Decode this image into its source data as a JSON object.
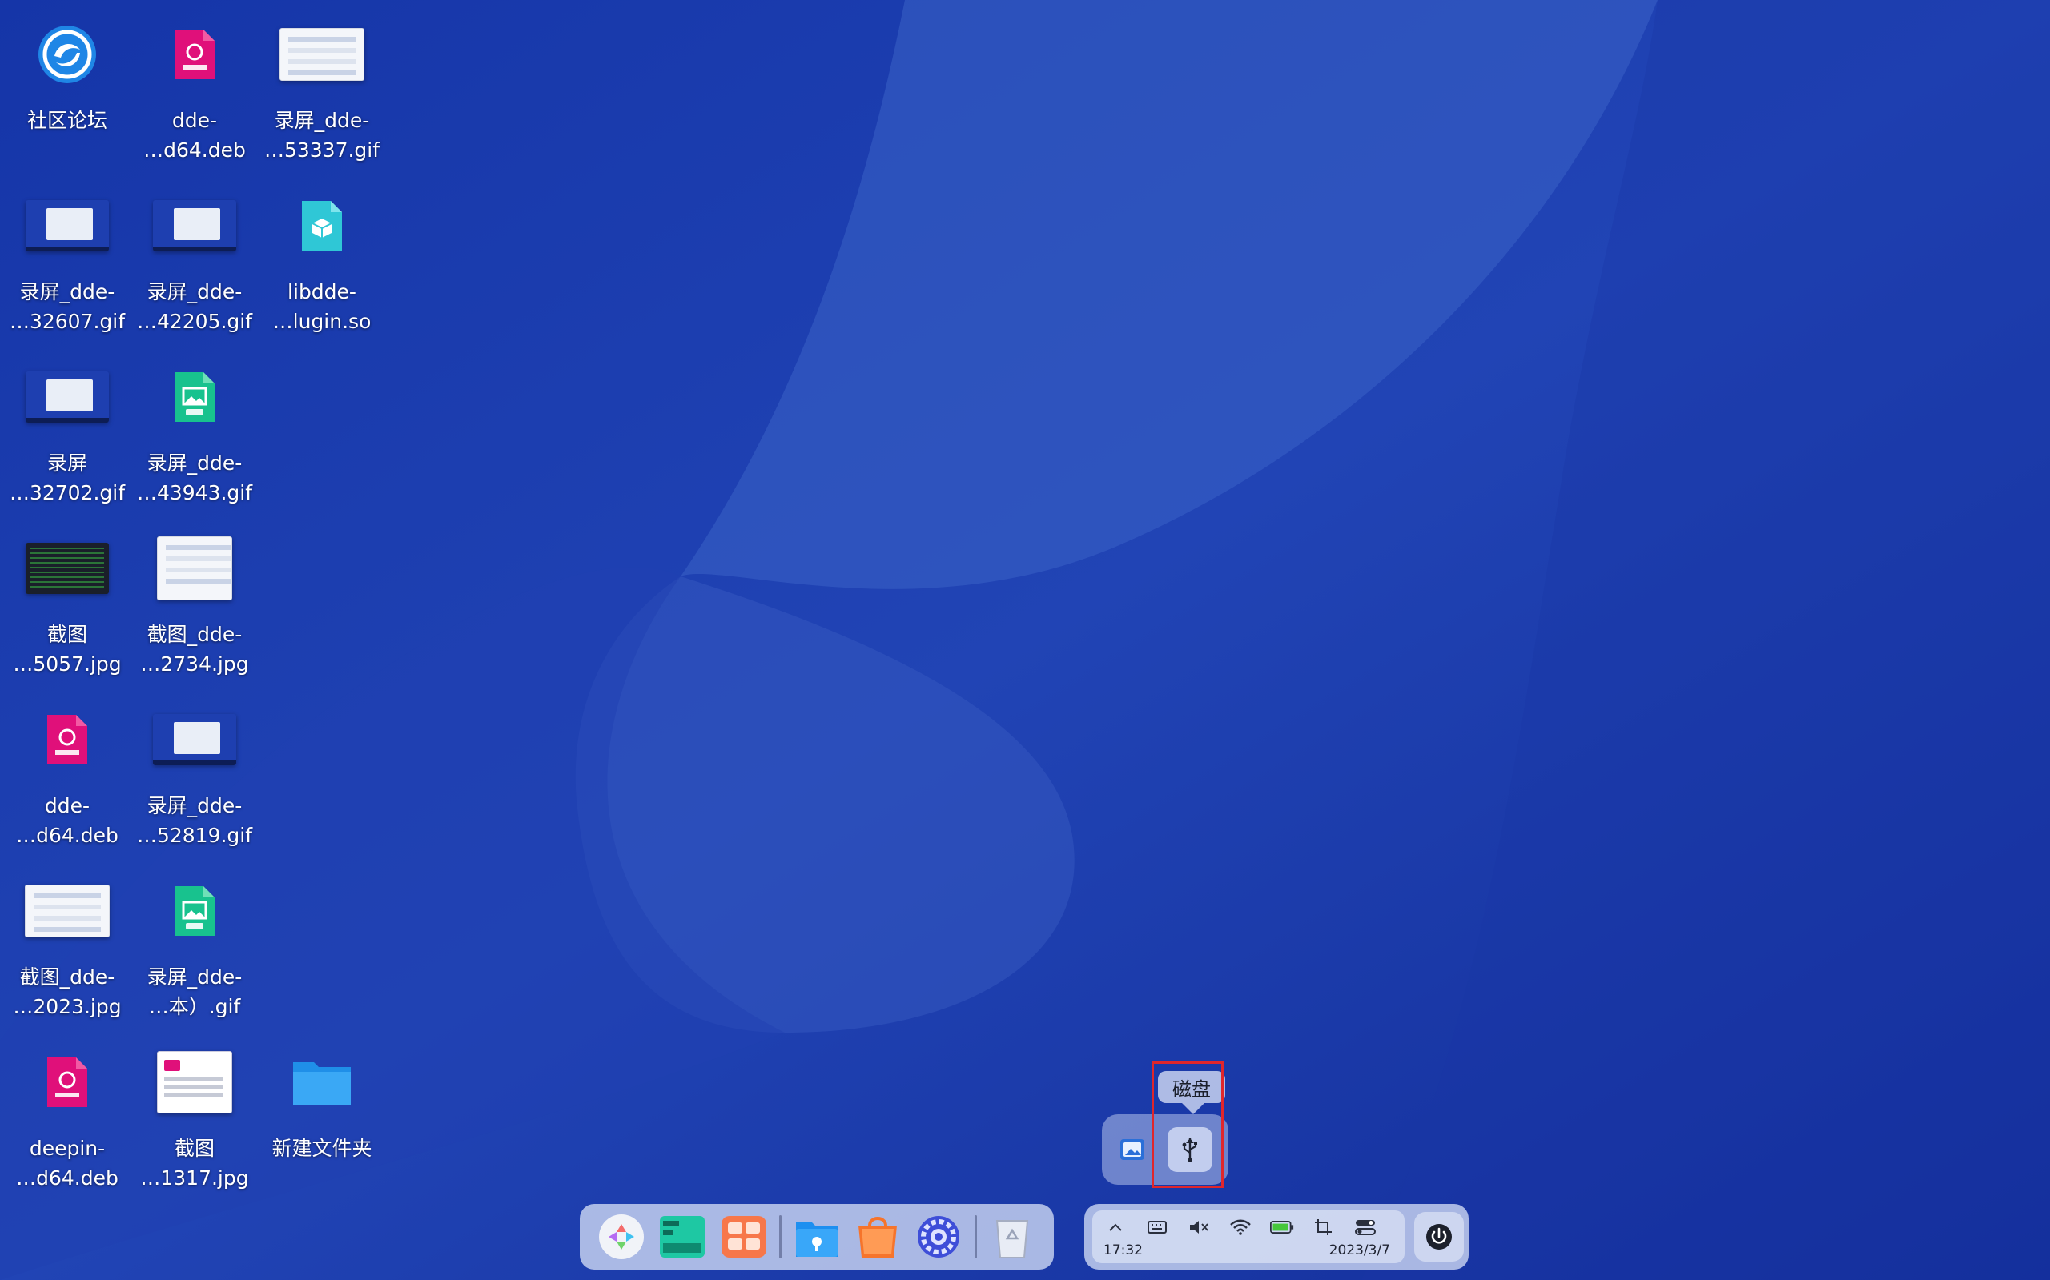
{
  "desktop": {
    "icons": [
      {
        "label": "社区论坛"
      },
      {
        "label": "dde-\n…d64.deb"
      },
      {
        "label": "录屏_dde-\n…53337.gif"
      },
      {
        "label": "录屏_dde-\n…32607.gif"
      },
      {
        "label": "录屏_dde-\n…42205.gif"
      },
      {
        "label": "libdde-\n…lugin.so"
      },
      {
        "label": "录屏\n…32702.gif"
      },
      {
        "label": "录屏_dde-\n…43943.gif"
      },
      {
        "label": "截图\n…5057.jpg"
      },
      {
        "label": "截图_dde-\n…2734.jpg"
      },
      {
        "label": "dde-\n…d64.deb"
      },
      {
        "label": "录屏_dde-\n…52819.gif"
      },
      {
        "label": "截图_dde-\n…2023.jpg"
      },
      {
        "label": "录屏_dde-\n…本）.gif"
      },
      {
        "label": "deepin-\n…d64.deb"
      },
      {
        "label": "截图\n…1317.jpg"
      },
      {
        "label": "新建文件夹"
      }
    ]
  },
  "dock": {
    "apps": [
      {
        "name": "launcher-icon"
      },
      {
        "name": "terminal-icon"
      },
      {
        "name": "multitask-icon"
      },
      {
        "name": "file-manager-icon"
      },
      {
        "name": "app-store-icon"
      },
      {
        "name": "control-center-icon"
      },
      {
        "name": "trash-icon"
      }
    ],
    "tray": {
      "time": "17:32",
      "date": "2023/3/7"
    }
  },
  "plugin_popup": {
    "tooltip": "磁盘"
  },
  "colors": {
    "highlight": "#e0262b",
    "debian_pink": "#e0107a",
    "gif_green": "#18c28e"
  }
}
